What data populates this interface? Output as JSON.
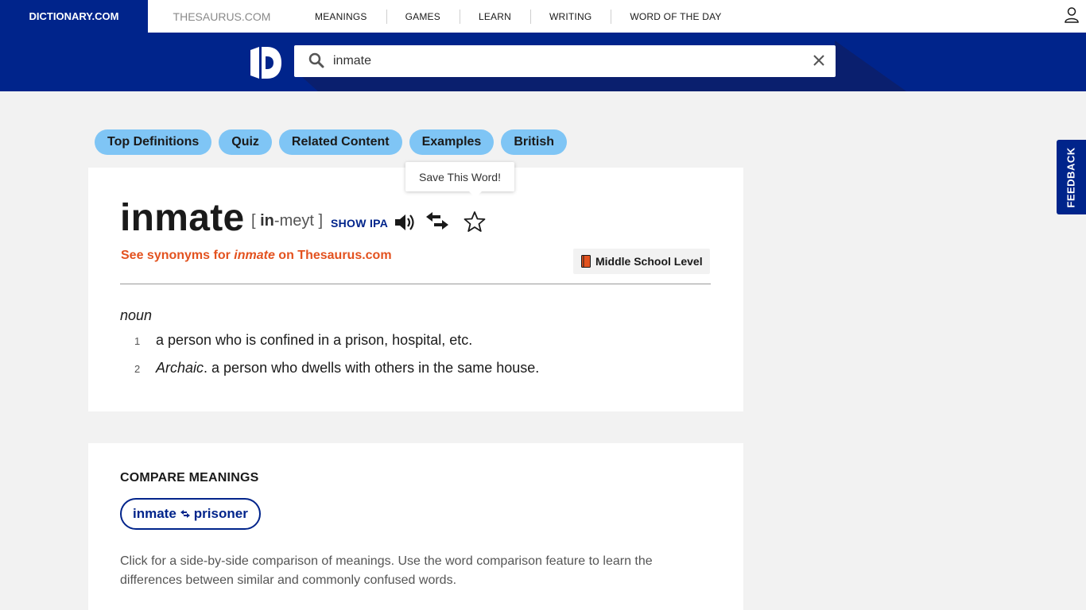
{
  "topnav": {
    "brand": "DICTIONARY.COM",
    "thesaurus": "THESAURUS.COM",
    "links": [
      "MEANINGS",
      "GAMES",
      "LEARN",
      "WRITING",
      "WORD OF THE DAY"
    ]
  },
  "search": {
    "value": "inmate"
  },
  "pills": [
    "Top Definitions",
    "Quiz",
    "Related Content",
    "Examples",
    "British"
  ],
  "tooltip": "Save This Word!",
  "entry": {
    "headword": "inmate",
    "pron_open": "[ ",
    "pron_stress": "in",
    "pron_rest": "-meyt ]",
    "show_ipa": "SHOW IPA",
    "syn_prefix": "See synonyms for ",
    "syn_word": "inmate",
    "syn_suffix": " on Thesaurus.com",
    "level": "Middle School Level",
    "pos": "noun",
    "definitions": [
      {
        "num": "1",
        "label": "",
        "text": "a person who is confined in a prison, hospital, etc."
      },
      {
        "num": "2",
        "label": "Archaic",
        "text": ". a person who dwells with others in the same house."
      }
    ]
  },
  "compare": {
    "title": "COMPARE MEANINGS",
    "word1": "inmate",
    "word2": "prisoner",
    "description": "Click for a side-by-side comparison of meanings. Use the word comparison feature to learn the differences between similar and commonly confused words."
  },
  "feedback": "FEEDBACK",
  "colors": {
    "brand_blue": "#00248b",
    "pill": "#7fc5f5",
    "synonym_link": "#e3521f"
  }
}
